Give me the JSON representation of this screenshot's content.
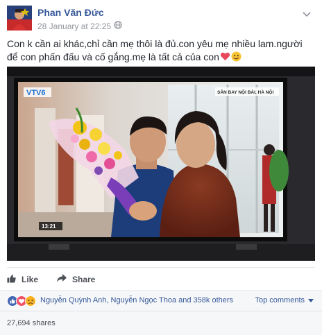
{
  "post": {
    "author": "Phan Văn Đức",
    "timestamp": "28 January at 22:25",
    "audience_icon": "globe-icon",
    "menu_icon": "chevron-down-icon",
    "text": "Con k cần ai khác,chỉ cần mẹ thôi là đủ.con yêu mẹ nhiều lam.người để con phấn đấu và cố gắng.mẹ là tất cả của con",
    "emojis": [
      "heart-icon",
      "smile-icon"
    ]
  },
  "photo": {
    "channel_logo": "VTV6",
    "location_caption": "SÂN BAY NỘI BÀI, HÀ NỘI",
    "clock": "13:21"
  },
  "actions": {
    "like_label": "Like",
    "share_label": "Share"
  },
  "reactions": {
    "icons": [
      "like-icon",
      "love-icon",
      "sad-icon"
    ],
    "summary": "Nguyễn Quỳnh Anh, Nguyễn Ngọc Thoa and 358k others",
    "sort_label": "Top comments"
  },
  "shares": {
    "label": "27,694 shares"
  },
  "colors": {
    "link": "#365899",
    "meta": "#90949c",
    "like_blue": "#4267b2",
    "love_red": "#f25268",
    "sad_yellow": "#f7b125"
  }
}
